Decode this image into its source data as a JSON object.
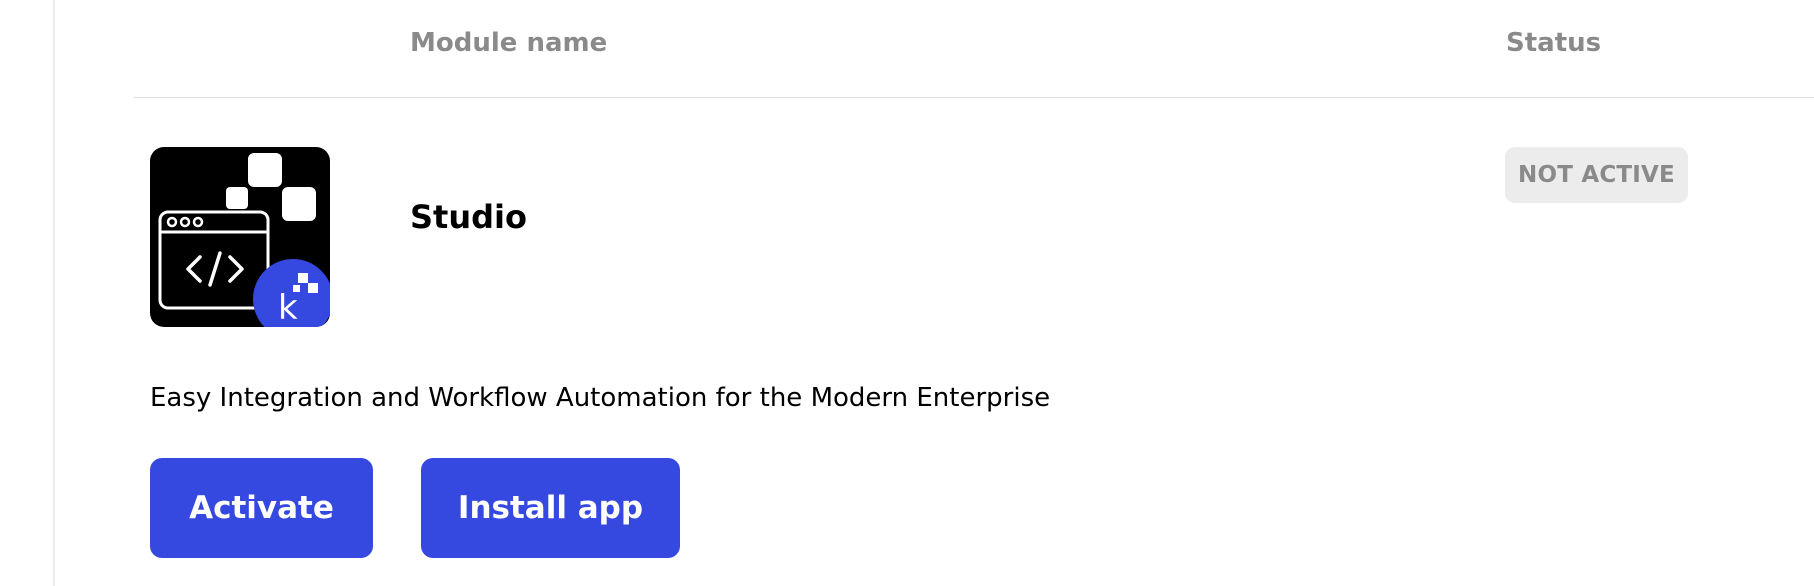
{
  "table": {
    "columns": {
      "module_name": "Module name",
      "status": "Status"
    }
  },
  "module": {
    "name": "Studio",
    "icon": "studio-code-window-icon",
    "badge_icon": "k-brand-icon",
    "status": "NOT ACTIVE",
    "description": "Easy Integration and Workflow Automation for the Modern Enterprise"
  },
  "actions": {
    "activate_label": "Activate",
    "install_label": "Install app"
  },
  "colors": {
    "primary": "#3548e0",
    "status_badge_bg": "#ececec",
    "muted_text": "#8a8a8a"
  }
}
